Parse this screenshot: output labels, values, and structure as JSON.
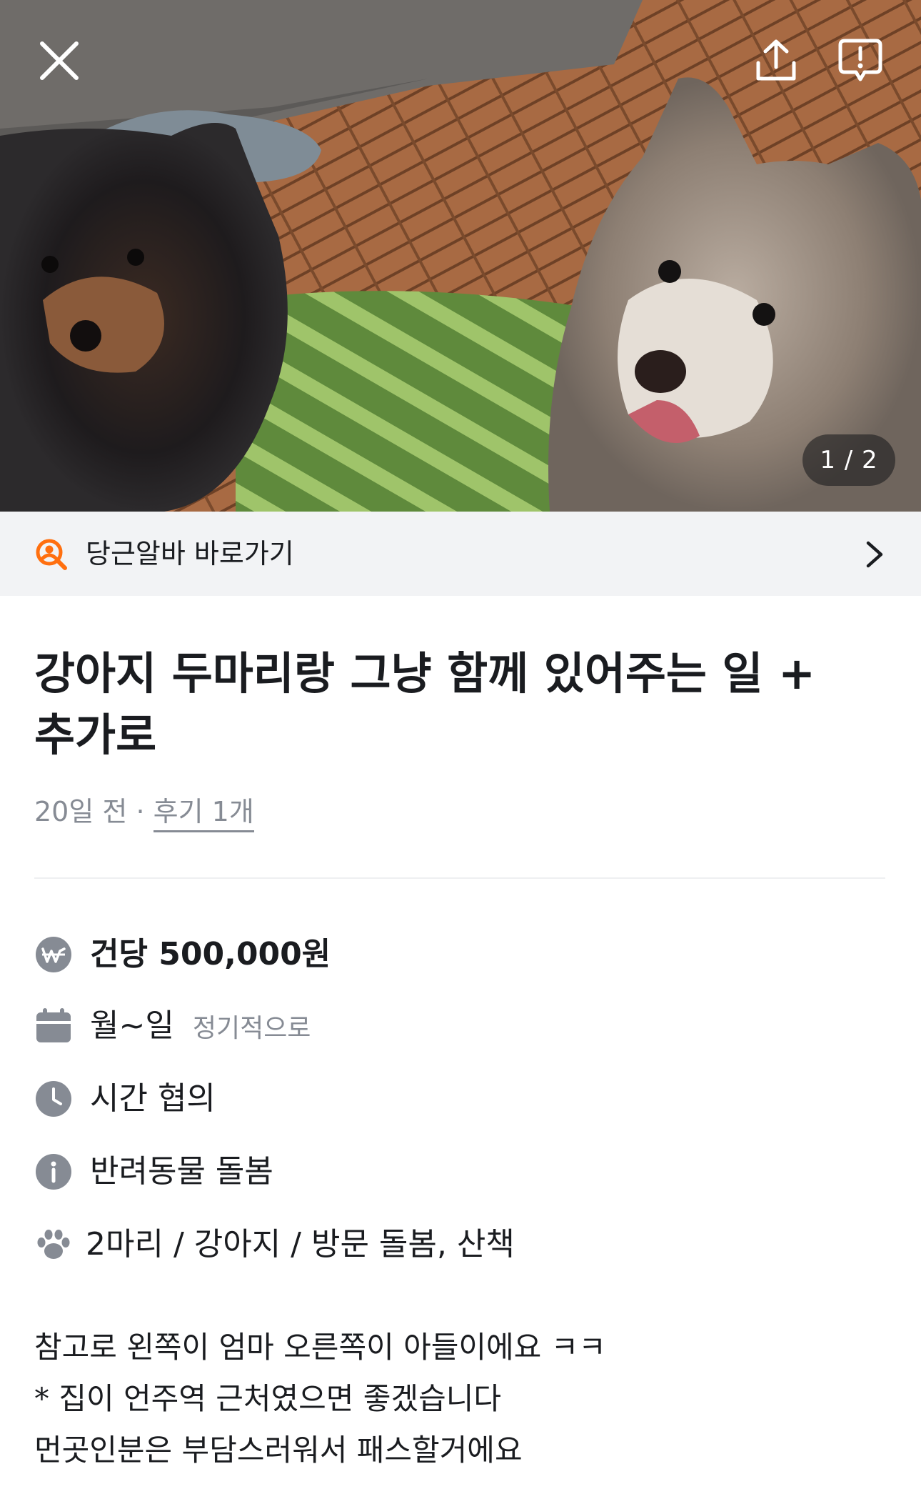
{
  "hero": {
    "counter": "1 / 2"
  },
  "promo": {
    "label": "당근알바 바로가기"
  },
  "post": {
    "title": "강아지 두마리랑 그냥 함께 있어주는 일 + 추가로",
    "time_ago": "20일 전",
    "separator": "·",
    "reviews": "후기 1개"
  },
  "details": {
    "pay": "건당 500,000원",
    "days": "월~일",
    "days_note": "정기적으로",
    "time": "시간 협의",
    "category": "반려동물 돌봄",
    "pets": "2마리 / 강아지 / 방문 돌봄, 산책"
  },
  "description": {
    "lines": [
      "참고로 왼쪽이 엄마 오른쪽이 아들이에요 ㅋㅋ",
      "* 집이 언주역 근처였으면 좋겠습니다",
      "먼곳인분은 부담스러워서 패스할거에요"
    ]
  },
  "colors": {
    "brand_orange": "#ff6f0f",
    "icon_gray": "#868b94",
    "promo_bg": "#f2f3f5"
  },
  "icons": [
    "close-icon",
    "share-icon",
    "report-icon",
    "search-person-icon",
    "chevron-right-icon",
    "won-icon",
    "calendar-icon",
    "clock-icon",
    "info-icon",
    "paw-icon"
  ]
}
